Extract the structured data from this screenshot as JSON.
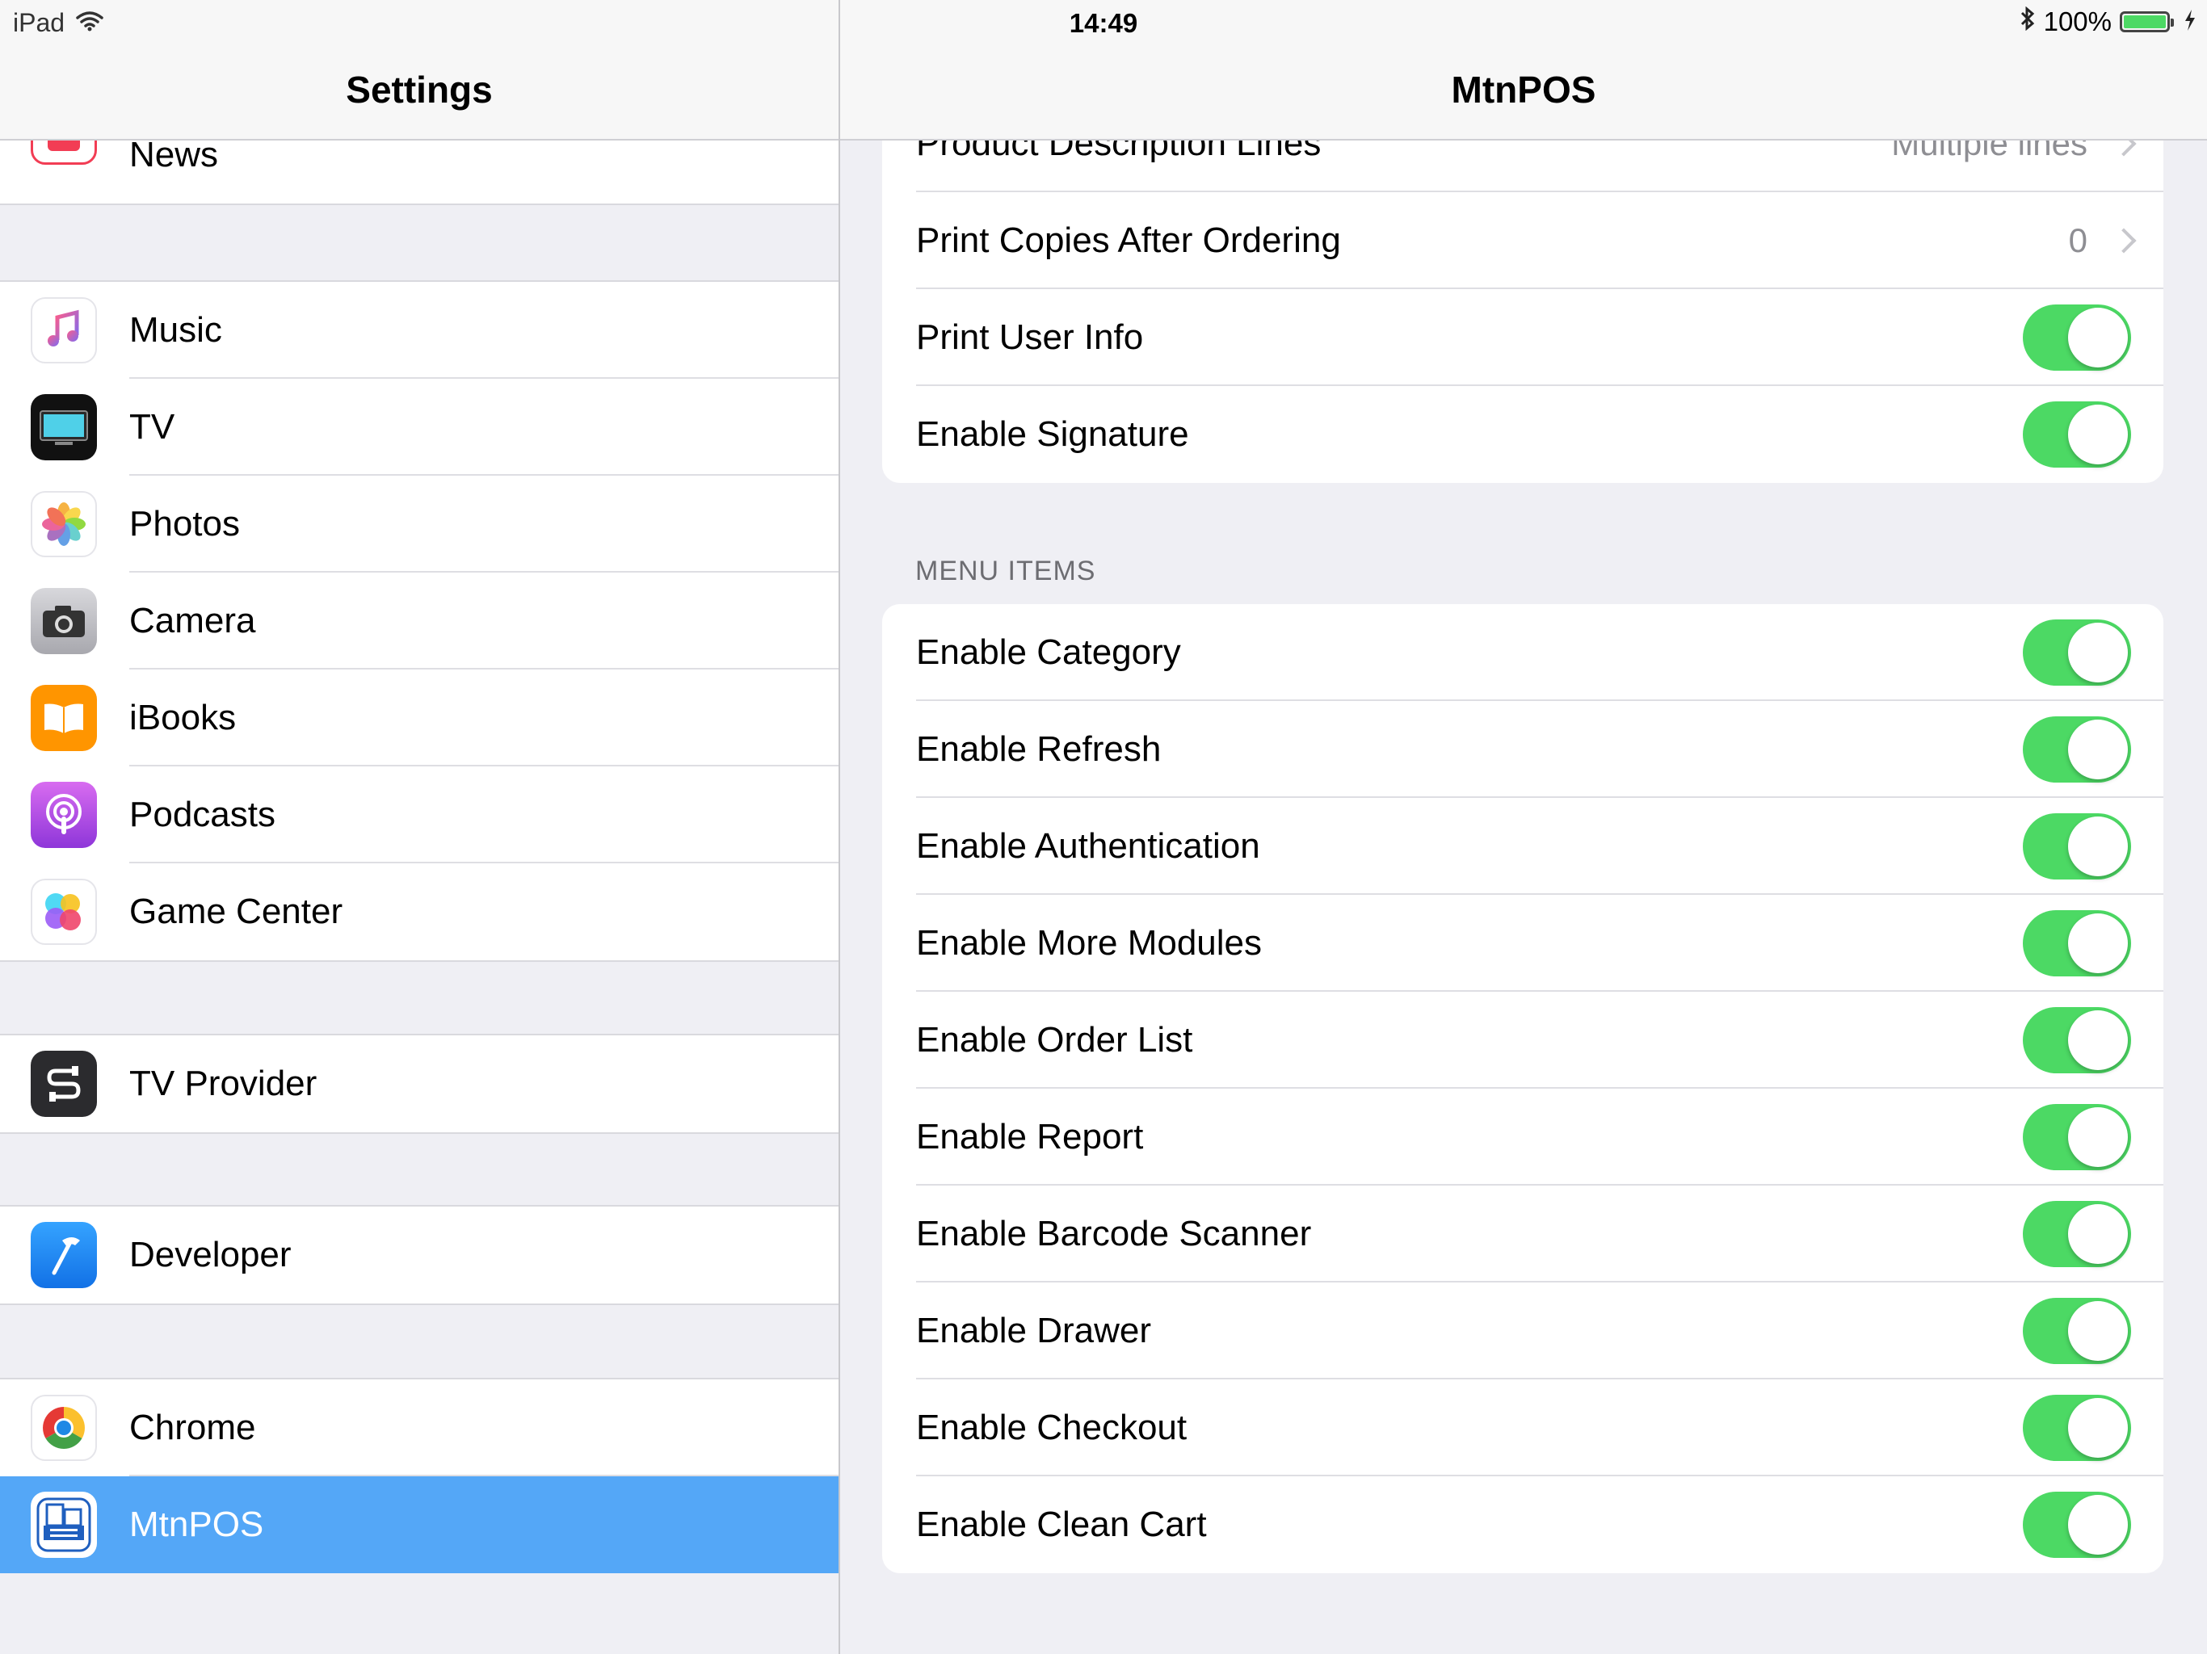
{
  "status_bar": {
    "device": "iPad",
    "time": "14:49",
    "battery_percent": "100%",
    "battery_level": 1.0,
    "icons": [
      "wifi-icon",
      "bluetooth-icon",
      "battery-icon",
      "charging-bolt-icon"
    ]
  },
  "sidebar": {
    "title": "Settings",
    "group_top": [
      {
        "label": "News",
        "icon": "news-icon"
      }
    ],
    "group_media": [
      {
        "label": "Music",
        "icon": "music-icon"
      },
      {
        "label": "TV",
        "icon": "tv-icon"
      },
      {
        "label": "Photos",
        "icon": "photos-icon"
      },
      {
        "label": "Camera",
        "icon": "camera-icon"
      },
      {
        "label": "iBooks",
        "icon": "ibooks-icon"
      },
      {
        "label": "Podcasts",
        "icon": "podcasts-icon"
      },
      {
        "label": "Game Center",
        "icon": "game-center-icon"
      }
    ],
    "group_provider": [
      {
        "label": "TV Provider",
        "icon": "tv-provider-icon"
      }
    ],
    "group_dev": [
      {
        "label": "Developer",
        "icon": "developer-icon"
      }
    ],
    "group_apps": [
      {
        "label": "Chrome",
        "icon": "chrome-icon"
      },
      {
        "label": "MtnPOS",
        "icon": "mtnpos-icon",
        "selected": true
      }
    ]
  },
  "detail": {
    "title": "MtnPOS",
    "top_rows": [
      {
        "label": "Product Description Lines",
        "value": "Multiple lines"
      },
      {
        "label": "Print Copies After Ordering",
        "value": "0"
      }
    ],
    "top_toggles": [
      {
        "label": "Print User Info",
        "on": true
      },
      {
        "label": "Enable Signature",
        "on": true
      }
    ],
    "menu_section_label": "MENU ITEMS",
    "menu_toggles": [
      {
        "label": "Enable Category",
        "on": true
      },
      {
        "label": "Enable Refresh",
        "on": true
      },
      {
        "label": "Enable Authentication",
        "on": true
      },
      {
        "label": "Enable More Modules",
        "on": true
      },
      {
        "label": "Enable Order List",
        "on": true
      },
      {
        "label": "Enable Report",
        "on": true
      },
      {
        "label": "Enable Barcode Scanner",
        "on": true
      },
      {
        "label": "Enable Drawer",
        "on": true
      },
      {
        "label": "Enable Checkout",
        "on": true
      },
      {
        "label": "Enable Clean Cart",
        "on": true
      }
    ]
  },
  "colors": {
    "toggle_on": "#4cd964",
    "selection": "#54a7f7",
    "background": "#efeff4"
  }
}
